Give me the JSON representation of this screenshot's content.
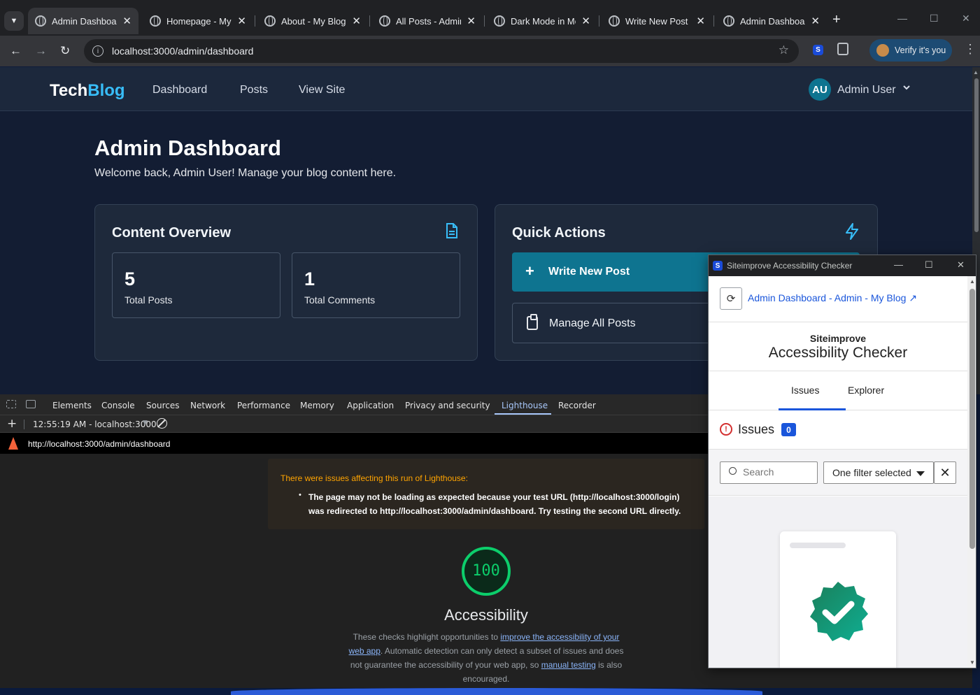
{
  "browser": {
    "tabs": [
      {
        "title": "Admin Dashboard",
        "active": true
      },
      {
        "title": "Homepage - My Blog",
        "active": false
      },
      {
        "title": "About - My Blog",
        "active": false
      },
      {
        "title": "All Posts - Admin",
        "active": false
      },
      {
        "title": "Dark Mode in Modern",
        "active": false
      },
      {
        "title": "Write New Post -",
        "active": false
      },
      {
        "title": "Admin Dashboard",
        "active": false
      }
    ],
    "new_tab": "+",
    "url": "localhost:3000/admin/dashboard",
    "verify_label": "Verify it's you",
    "extension_s": "S"
  },
  "site": {
    "logo_part1": "Tech",
    "logo_part2": "Blog",
    "nav": [
      "Dashboard",
      "Posts",
      "View Site"
    ],
    "user_initials": "AU",
    "user_name": "Admin User",
    "page_title": "Admin Dashboard",
    "page_subtitle": "Welcome back, Admin User! Manage your blog content here.",
    "content_overview": {
      "title": "Content Overview",
      "stats": [
        {
          "value": "5",
          "label": "Total Posts"
        },
        {
          "value": "1",
          "label": "Total Comments"
        }
      ]
    },
    "quick_actions": {
      "title": "Quick Actions",
      "primary": "Write New Post",
      "secondary": "Manage All Posts"
    },
    "colors": {
      "accent": "#38bdf8",
      "primary_button": "#0e7490",
      "background": "#131d33",
      "card": "#1e293b"
    }
  },
  "devtools": {
    "tabs": [
      "Elements",
      "Console",
      "Sources",
      "Network",
      "Performance",
      "Memory",
      "Application",
      "Privacy and security",
      "Lighthouse",
      "Recorder"
    ],
    "active_tab": "Lighthouse",
    "session": "12:55:19 AM - localhost:3000",
    "report_url": "http://localhost:3000/admin/dashboard",
    "warning_title": "There were issues affecting this run of Lighthouse:",
    "warning_item": "The page may not be loading as expected because your test URL (http://localhost:3000/login) was redirected to http://localhost:3000/admin/dashboard. Try testing the second URL directly.",
    "score": "100",
    "category": "Accessibility",
    "desc_part1": "These checks highlight opportunities to ",
    "desc_link1": "improve the accessibility of your web app",
    "desc_part2": ". Automatic detection can only detect a subset of issues and does not guarantee the accessibility of your web app, so ",
    "desc_link2": "manual testing",
    "desc_part3": " is also encouraged."
  },
  "siteimprove": {
    "window_title": "Siteimprove Accessibility Checker",
    "page_link": "Admin Dashboard - Admin - My Blog ↗",
    "brand_line1": "Siteimprove",
    "brand_line2": "Accessibility Checker",
    "tabs": [
      "Issues",
      "Explorer"
    ],
    "active_tab": "Issues",
    "issues_label": "Issues",
    "issues_count": "0",
    "search_placeholder": "Search",
    "filter_value": "One filter selected",
    "colors": {
      "link": "#1a56db",
      "badge": "#1a56db",
      "seal": "#0f9f7e"
    }
  }
}
